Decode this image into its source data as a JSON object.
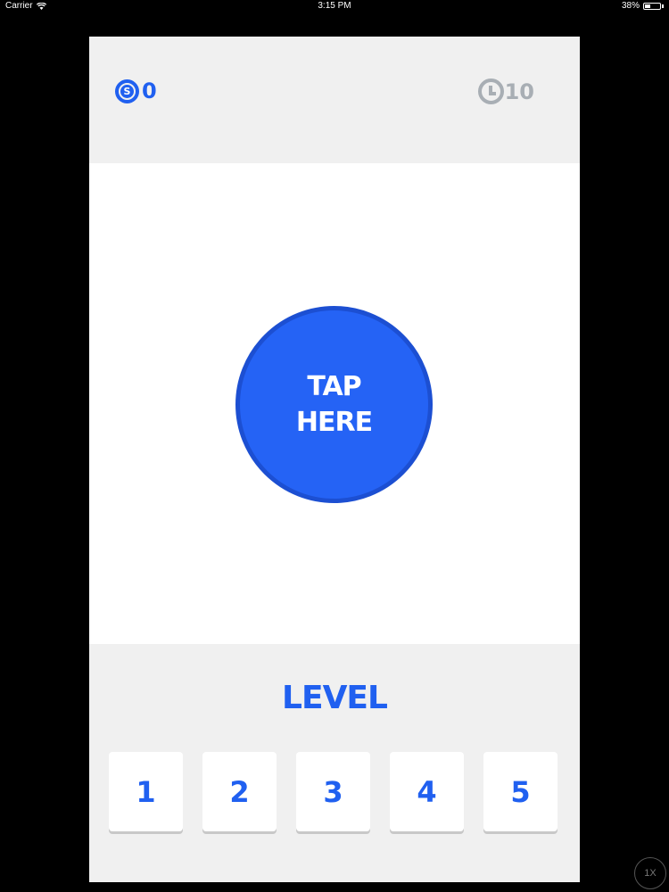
{
  "status_bar": {
    "carrier": "Carrier",
    "time": "3:15 PM",
    "battery": "38%",
    "battery_level": 0.38
  },
  "header": {
    "score_icon": "dollar-coin-icon",
    "score_icon_glyph": "S",
    "score_value": "0",
    "timer_icon": "clock-icon",
    "timer_value": "10"
  },
  "main": {
    "tap_button_lines": [
      "TAP",
      "HERE"
    ]
  },
  "level_panel": {
    "title": "LEVEL",
    "levels": [
      "1",
      "2",
      "3",
      "4",
      "5"
    ]
  },
  "overlay": {
    "speed_badge": "1X"
  },
  "colors": {
    "accent_blue": "#2563f5",
    "timer_gray": "#a8aeb4",
    "panel_gray": "#f0f0f0",
    "background": "#000000"
  }
}
